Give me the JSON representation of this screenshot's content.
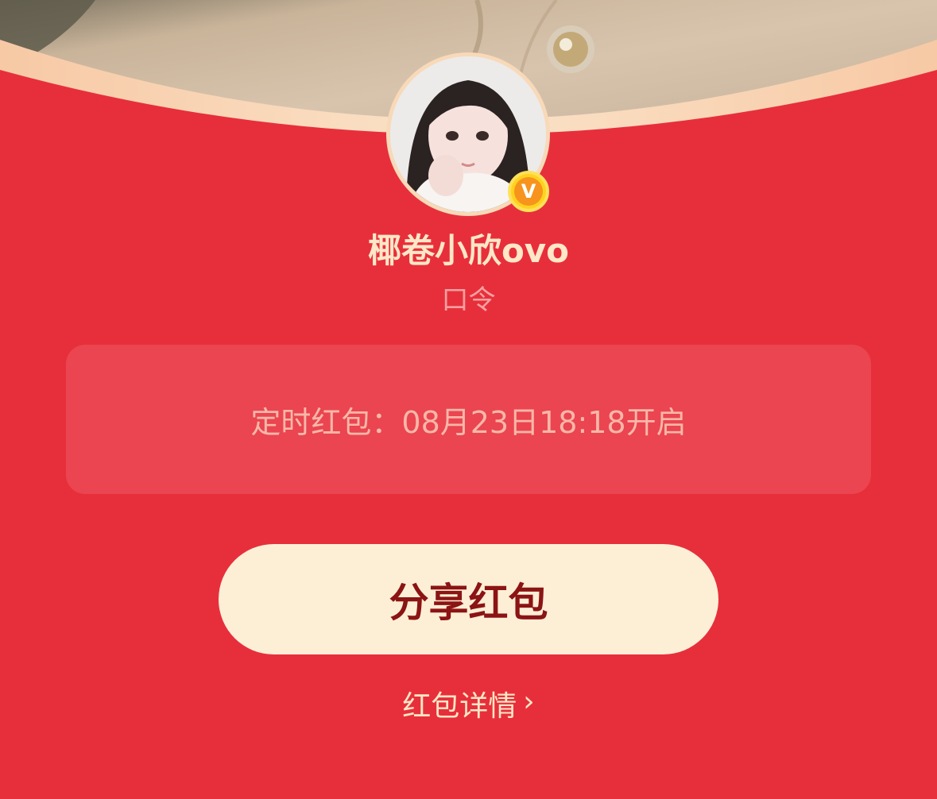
{
  "profile": {
    "name": "椰卷小欣ovo",
    "subtitle": "口令",
    "verified_badge": "V"
  },
  "timer": {
    "text": "定时红包：08月23日18:18开启"
  },
  "actions": {
    "share_label": "分享红包",
    "details_label": "红包详情",
    "details_chevron": "›"
  },
  "colors": {
    "background": "#e72f3b",
    "card": "#ea4550",
    "button": "#fdefd6",
    "button_text": "#8b1414",
    "name_text": "#ffe7c7",
    "badge": "#f7941d"
  },
  "icons": {
    "verified": "verified-v-icon",
    "details": "chevron-right-icon"
  }
}
